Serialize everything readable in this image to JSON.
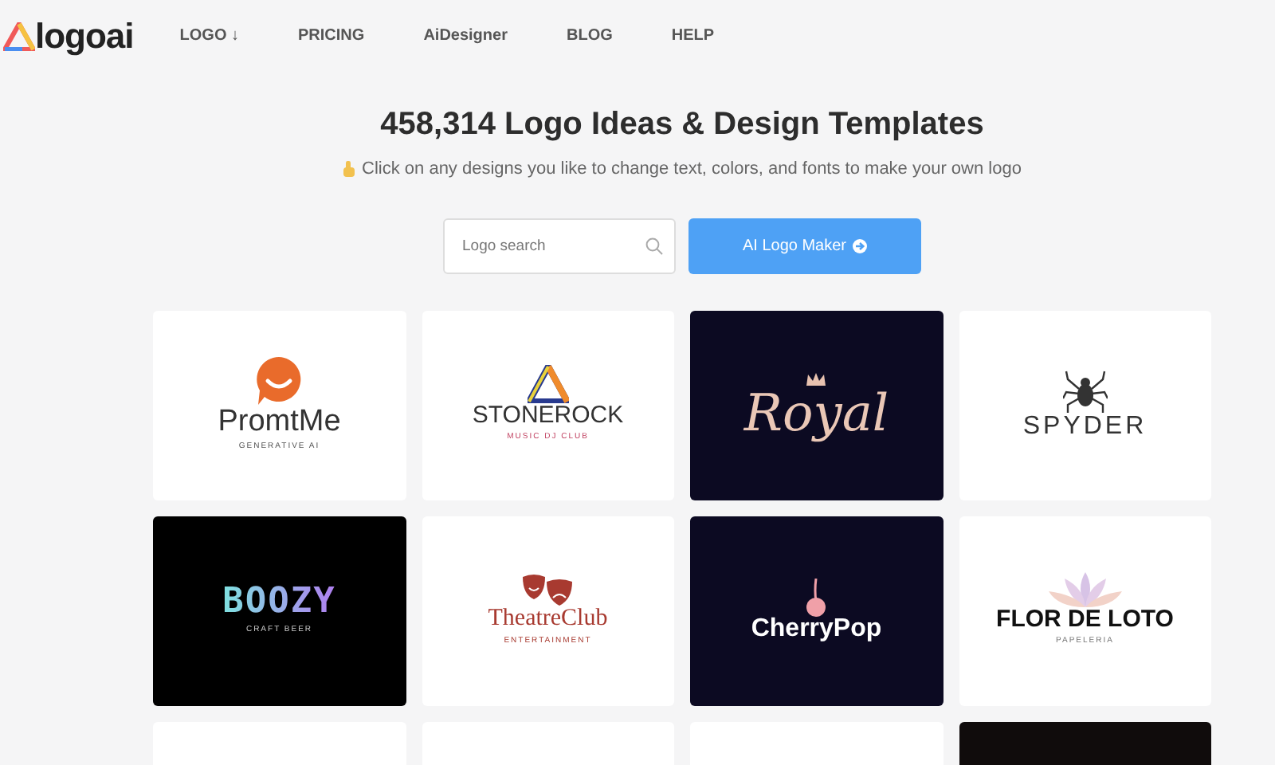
{
  "header": {
    "logo": "logoai",
    "nav": [
      {
        "label": "LOGO ↓"
      },
      {
        "label": "PRICING"
      },
      {
        "label": "AiDesigner"
      },
      {
        "label": "BLOG"
      },
      {
        "label": "HELP"
      }
    ]
  },
  "hero": {
    "title": "458,314 Logo Ideas & Design Templates",
    "subtitle": "Click on any designs you like to change text, colors, and fonts to make your own logo",
    "search": {
      "placeholder": "Logo search"
    },
    "button": "AI Logo Maker"
  },
  "cards": [
    {
      "kind": "speech",
      "name": "PromtMe",
      "tagline": "GENERATIVE AI"
    },
    {
      "kind": "triangle",
      "name": "STONEROCK",
      "tagline": "MUSIC DJ CLUB"
    },
    {
      "kind": "crown",
      "name": "Royal"
    },
    {
      "kind": "spider",
      "name": "SPYDER"
    },
    {
      "kind": "neon",
      "name": "BOOZY",
      "tagline": "CRAFT BEER"
    },
    {
      "kind": "masks",
      "name": "TheatreClub",
      "tagline": "ENTERTAINMENT"
    },
    {
      "kind": "cherry",
      "name": "CherryPop"
    },
    {
      "kind": "lotus",
      "name": "FLOR DE LOTO",
      "tagline": "PAPELERIA"
    },
    {
      "kind": "blank-light"
    },
    {
      "kind": "blank-light"
    },
    {
      "kind": "blank-light"
    },
    {
      "kind": "blank-dark"
    }
  ]
}
